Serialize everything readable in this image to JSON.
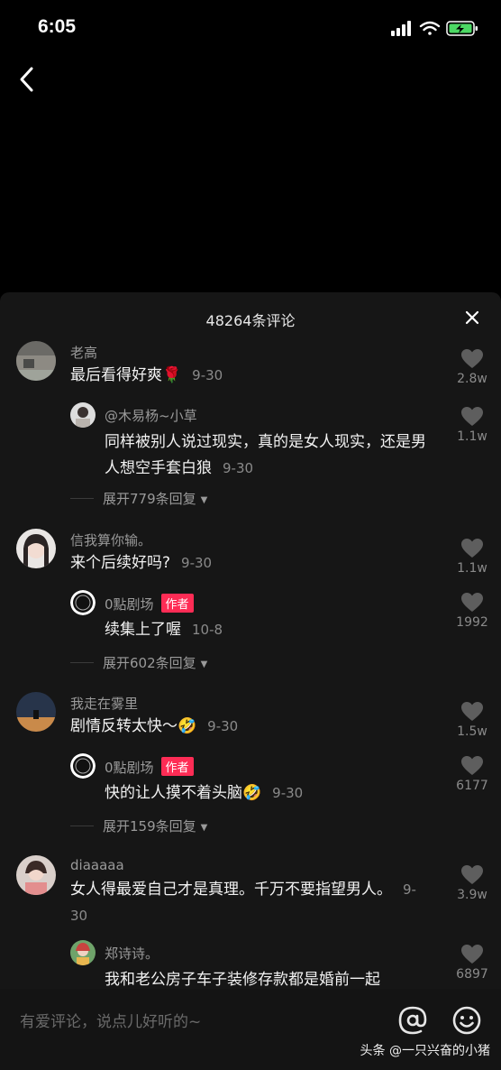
{
  "status": {
    "time": "6:05"
  },
  "sheet": {
    "title": "48264条评论"
  },
  "comments": [
    {
      "user": "老高",
      "text": "最后看得好爽🌹",
      "date": "9-30",
      "likes": "2.8w",
      "reply": {
        "user": "@木易杨~小草",
        "text": "同样被别人说过现实，真的是女人现实，还是男人想空手套白狼",
        "date": "9-30",
        "likes": "1.1w"
      },
      "expand": "展开779条回复"
    },
    {
      "user": "信我算你输。",
      "text": "来个后续好吗?",
      "date": "9-30",
      "likes": "1.1w",
      "reply": {
        "user": "0點剧场",
        "badge": "作者",
        "text": "续集上了喔",
        "date": "10-8",
        "likes": "1992"
      },
      "expand": "展开602条回复"
    },
    {
      "user": "我走在雾里",
      "text": "剧情反转太快～🤣",
      "date": "9-30",
      "likes": "1.5w",
      "reply": {
        "user": "0點剧场",
        "badge": "作者",
        "text": "快的让人摸不着头脑🤣",
        "date": "9-30",
        "likes": "6177"
      },
      "expand": "展开159条回复"
    },
    {
      "user": "diaaaaa",
      "text": "女人得最爱自己才是真理。千万不要指望男人。",
      "date": "9-30",
      "likes": "3.9w",
      "reply": {
        "user": "郑诗诗。",
        "text": "我和老公房子车子装修存款都是婚前一起",
        "date": "",
        "likes": "6897"
      },
      "expand": ""
    }
  ],
  "input": {
    "placeholder": "有爱评论，说点儿好听的~"
  },
  "watermark": "头条 @一只兴奋的小猪",
  "colors": {
    "accent": "#fe2c55",
    "sheet_bg": "#161616"
  }
}
